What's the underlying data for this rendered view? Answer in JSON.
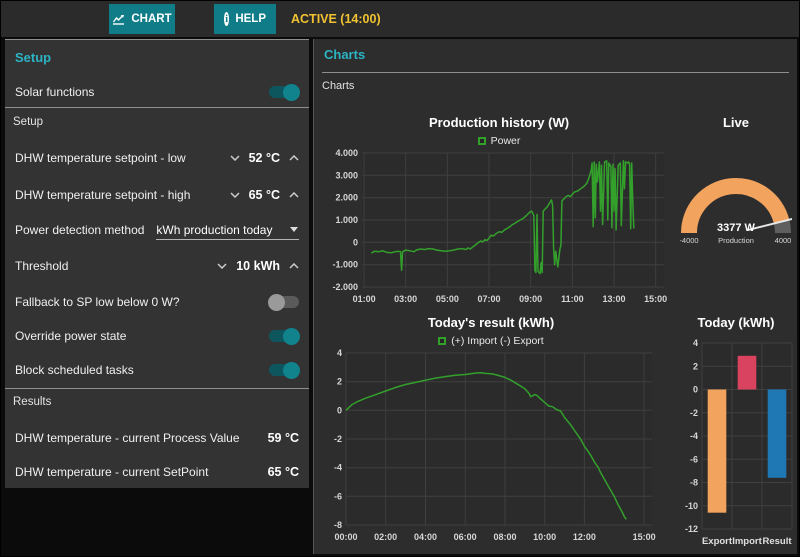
{
  "topbar": {
    "chart_button": "CHART",
    "help_button": "HELP",
    "status": "ACTIVE (14:00)"
  },
  "setup_panel": {
    "title": "Setup",
    "solar_functions": {
      "label": "Solar functions",
      "state": "on"
    },
    "section_setup": "Setup",
    "dhw_low": {
      "label": "DHW temperature setpoint - low",
      "value": "52 °C"
    },
    "dhw_high": {
      "label": "DHW temperature setpoint - high",
      "value": "65 °C"
    },
    "power_detection": {
      "label": "Power detection method",
      "value": "kWh production today"
    },
    "threshold": {
      "label": "Threshold",
      "value": "10 kWh"
    },
    "fallback": {
      "label": "Fallback to SP low below 0 W?",
      "state": "off"
    },
    "override_power": {
      "label": "Override power state",
      "state": "on"
    },
    "block_tasks": {
      "label": "Block scheduled tasks",
      "state": "on"
    },
    "section_results": "Results",
    "process_value": {
      "label": "DHW temperature - current Process Value",
      "value": "59 °C"
    },
    "current_setpoint": {
      "label": "DHW temperature - current SetPoint",
      "value": "65 °C"
    }
  },
  "charts_panel": {
    "title": "Charts",
    "subtitle": "Charts"
  },
  "colors": {
    "accent_teal": "#0f7c87",
    "header_teal": "#2cb3c4",
    "status_yellow": "#f1c232",
    "line_green": "#33a02c",
    "bar_orange": "#f2a35e",
    "bar_red": "#d9435f",
    "bar_blue": "#1f77b4",
    "gauge_orange": "#f2a35e",
    "gauge_rest_gray": "#5f5f5f"
  },
  "chart_data": [
    {
      "id": "production_history",
      "type": "line",
      "title": "Production history (W)",
      "legend": "Power",
      "line_color": "#33a02c",
      "xlim": [
        0.9,
        15.4
      ],
      "ylim": [
        -2000,
        4000
      ],
      "x_ticks": [
        {
          "v": 1,
          "label": "01:00"
        },
        {
          "v": 3,
          "label": "03:00"
        },
        {
          "v": 5,
          "label": "05:00"
        },
        {
          "v": 7,
          "label": "07:00"
        },
        {
          "v": 9,
          "label": "09:00"
        },
        {
          "v": 11,
          "label": "11:00"
        },
        {
          "v": 13,
          "label": "13:00"
        },
        {
          "v": 15,
          "label": "15:00"
        }
      ],
      "y_ticks": [
        {
          "v": 4000,
          "label": "4.000"
        },
        {
          "v": 3000,
          "label": "3.000"
        },
        {
          "v": 2000,
          "label": "2.000"
        },
        {
          "v": 1000,
          "label": "1.000"
        },
        {
          "v": 0,
          "label": "0"
        },
        {
          "v": -1000,
          "label": "-1.000"
        },
        {
          "v": -2000,
          "label": "-2.000"
        }
      ],
      "points": [
        [
          1.35,
          -480
        ],
        [
          1.5,
          -400
        ],
        [
          1.7,
          -420
        ],
        [
          1.9,
          -380
        ],
        [
          2.1,
          -450
        ],
        [
          2.3,
          -470
        ],
        [
          2.5,
          -420
        ],
        [
          2.65,
          -400
        ],
        [
          2.75,
          -420
        ],
        [
          2.8,
          -1250
        ],
        [
          2.85,
          -420
        ],
        [
          3.0,
          -350
        ],
        [
          3.2,
          -380
        ],
        [
          3.4,
          -420
        ],
        [
          3.5,
          -350
        ],
        [
          3.7,
          -300
        ],
        [
          3.9,
          -320
        ],
        [
          4.1,
          -280
        ],
        [
          4.3,
          -300
        ],
        [
          4.5,
          -350
        ],
        [
          4.7,
          -380
        ],
        [
          4.9,
          -400
        ],
        [
          5.1,
          -380
        ],
        [
          5.3,
          -350
        ],
        [
          5.5,
          -300
        ],
        [
          5.7,
          -280
        ],
        [
          5.9,
          -320
        ],
        [
          6.0,
          -250
        ],
        [
          6.1,
          -300
        ],
        [
          6.25,
          -180
        ],
        [
          6.4,
          -80
        ],
        [
          6.5,
          0
        ],
        [
          6.6,
          60
        ],
        [
          6.7,
          20
        ],
        [
          6.8,
          120
        ],
        [
          6.9,
          80
        ],
        [
          7.0,
          180
        ],
        [
          7.1,
          320
        ],
        [
          7.2,
          280
        ],
        [
          7.35,
          400
        ],
        [
          7.5,
          480
        ],
        [
          7.6,
          440
        ],
        [
          7.75,
          560
        ],
        [
          7.9,
          640
        ],
        [
          8.0,
          700
        ],
        [
          8.1,
          780
        ],
        [
          8.25,
          860
        ],
        [
          8.4,
          950
        ],
        [
          8.5,
          1000
        ],
        [
          8.65,
          1080
        ],
        [
          8.8,
          1200
        ],
        [
          8.95,
          1350
        ],
        [
          9.05,
          1400
        ],
        [
          9.1,
          1300
        ],
        [
          9.15,
          1200
        ],
        [
          9.2,
          -1250
        ],
        [
          9.25,
          -1350
        ],
        [
          9.3,
          1250
        ],
        [
          9.35,
          -1300
        ],
        [
          9.45,
          -1400
        ],
        [
          9.5,
          -900
        ],
        [
          9.55,
          -1350
        ],
        [
          9.6,
          1400
        ],
        [
          9.7,
          1500
        ],
        [
          9.8,
          1600
        ],
        [
          9.9,
          1750
        ],
        [
          10.0,
          1900
        ],
        [
          10.05,
          1650
        ],
        [
          10.1,
          -250
        ],
        [
          10.15,
          -1000
        ],
        [
          10.2,
          -400
        ],
        [
          10.3,
          -1100
        ],
        [
          10.4,
          -300
        ],
        [
          10.45,
          -150
        ],
        [
          10.5,
          1850
        ],
        [
          10.6,
          1950
        ],
        [
          10.7,
          2050
        ],
        [
          10.8,
          2100
        ],
        [
          10.9,
          2050
        ],
        [
          11.0,
          2150
        ],
        [
          11.1,
          2250
        ],
        [
          11.25,
          2300
        ],
        [
          11.4,
          2400
        ],
        [
          11.55,
          2500
        ],
        [
          11.7,
          2650
        ],
        [
          11.8,
          2900
        ],
        [
          11.9,
          3200
        ],
        [
          11.95,
          3550
        ],
        [
          12.0,
          700
        ],
        [
          12.05,
          3600
        ],
        [
          12.1,
          1100
        ],
        [
          12.15,
          3500
        ],
        [
          12.2,
          2700
        ],
        [
          12.3,
          3600
        ],
        [
          12.35,
          1400
        ],
        [
          12.4,
          3450
        ],
        [
          12.45,
          800
        ],
        [
          12.55,
          3600
        ],
        [
          12.65,
          3650
        ],
        [
          12.7,
          1000
        ],
        [
          12.75,
          3550
        ],
        [
          12.85,
          3400
        ],
        [
          12.9,
          650
        ],
        [
          12.95,
          3500
        ],
        [
          13.0,
          1400
        ],
        [
          13.05,
          3300
        ],
        [
          13.1,
          550
        ],
        [
          13.2,
          3450
        ],
        [
          13.3,
          3550
        ],
        [
          13.35,
          750
        ],
        [
          13.45,
          3650
        ],
        [
          13.5,
          2400
        ],
        [
          13.55,
          3600
        ],
        [
          13.65,
          3550
        ],
        [
          13.7,
          3600
        ],
        [
          13.75,
          3500
        ],
        [
          13.8,
          600
        ],
        [
          13.85,
          3550
        ],
        [
          13.9,
          1800
        ],
        [
          13.95,
          620
        ]
      ]
    },
    {
      "id": "live_gauge",
      "type": "gauge",
      "title": "Live",
      "value": 3377,
      "value_label": "3377 W",
      "min": -4000,
      "max": 4000,
      "min_label": "-4000",
      "max_label": "4000",
      "caption": "Production",
      "fill_color": "#f2a35e",
      "rest_color": "#5f5f5f"
    },
    {
      "id": "todays_result",
      "type": "line",
      "title": "Today's result (kWh)",
      "legend": "(+) Import (-) Export",
      "line_color": "#33a02c",
      "xlim": [
        0,
        15.4
      ],
      "ylim": [
        -8,
        4
      ],
      "x_ticks": [
        {
          "v": 0,
          "label": "00:00"
        },
        {
          "v": 2,
          "label": "02:00"
        },
        {
          "v": 4,
          "label": "04:00"
        },
        {
          "v": 6,
          "label": "06:00"
        },
        {
          "v": 8,
          "label": "08:00"
        },
        {
          "v": 10,
          "label": "10:00"
        },
        {
          "v": 12,
          "label": "12:00"
        },
        {
          "v": 15,
          "label": "15:00"
        }
      ],
      "y_ticks": [
        {
          "v": 4,
          "label": "4"
        },
        {
          "v": 2,
          "label": "2"
        },
        {
          "v": 0,
          "label": "0"
        },
        {
          "v": -2,
          "label": "-2"
        },
        {
          "v": -4,
          "label": "-4"
        },
        {
          "v": -6,
          "label": "-6"
        },
        {
          "v": -8,
          "label": "-8"
        }
      ],
      "points": [
        [
          0,
          0
        ],
        [
          0.3,
          0.4
        ],
        [
          0.6,
          0.62
        ],
        [
          1.0,
          0.85
        ],
        [
          1.5,
          1.1
        ],
        [
          2.0,
          1.35
        ],
        [
          2.5,
          1.6
        ],
        [
          3.0,
          1.8
        ],
        [
          3.5,
          1.95
        ],
        [
          4.0,
          2.1
        ],
        [
          4.5,
          2.25
        ],
        [
          5.0,
          2.35
        ],
        [
          5.5,
          2.45
        ],
        [
          6.0,
          2.5
        ],
        [
          6.5,
          2.6
        ],
        [
          6.8,
          2.62
        ],
        [
          7.0,
          2.58
        ],
        [
          7.3,
          2.55
        ],
        [
          7.5,
          2.5
        ],
        [
          8.0,
          2.3
        ],
        [
          8.3,
          2.1
        ],
        [
          8.6,
          1.85
        ],
        [
          9.0,
          1.5
        ],
        [
          9.2,
          1.2
        ],
        [
          9.3,
          0.95
        ],
        [
          9.5,
          1.1
        ],
        [
          9.6,
          1.05
        ],
        [
          9.8,
          0.8
        ],
        [
          10.0,
          0.55
        ],
        [
          10.2,
          0.3
        ],
        [
          10.4,
          0.25
        ],
        [
          10.6,
          0.05
        ],
        [
          10.8,
          -0.05
        ],
        [
          11.0,
          -0.5
        ],
        [
          11.3,
          -1.0
        ],
        [
          11.5,
          -1.4
        ],
        [
          11.8,
          -2.0
        ],
        [
          12.0,
          -2.5
        ],
        [
          12.3,
          -3.1
        ],
        [
          12.5,
          -3.6
        ],
        [
          12.7,
          -4.0
        ],
        [
          12.8,
          -4.3
        ],
        [
          13.0,
          -4.8
        ],
        [
          13.2,
          -5.3
        ],
        [
          13.5,
          -6.0
        ],
        [
          13.7,
          -6.6
        ],
        [
          13.9,
          -7.1
        ],
        [
          14.0,
          -7.4
        ],
        [
          14.1,
          -7.6
        ]
      ]
    },
    {
      "id": "today_bars",
      "type": "bar",
      "title": "Today (kWh)",
      "categories": [
        "Export",
        "Import",
        "Result"
      ],
      "values": [
        -10.6,
        2.9,
        -7.6
      ],
      "bar_colors": [
        "#f2a35e",
        "#d9435f",
        "#1f77b4"
      ],
      "ylim": [
        -12,
        4
      ],
      "y_ticks": [
        {
          "v": 4,
          "label": "4"
        },
        {
          "v": 2,
          "label": "2"
        },
        {
          "v": 0,
          "label": "0"
        },
        {
          "v": -2,
          "label": "-2"
        },
        {
          "v": -4,
          "label": "-4"
        },
        {
          "v": -6,
          "label": "-6"
        },
        {
          "v": -8,
          "label": "-8"
        },
        {
          "v": -10,
          "label": "-10"
        },
        {
          "v": -12,
          "label": "-12"
        }
      ]
    }
  ]
}
